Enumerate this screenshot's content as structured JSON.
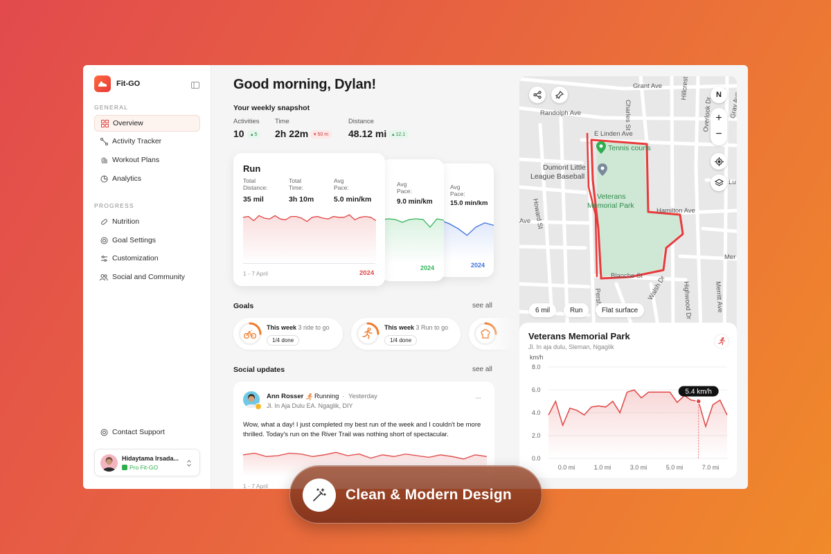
{
  "app": {
    "brand": "Fit-GO"
  },
  "sidebar": {
    "general_label": "GENERAL",
    "progress_label": "PROGRESS",
    "general_items": [
      {
        "label": "Overview",
        "icon": "grid-icon"
      },
      {
        "label": "Activity Tracker",
        "icon": "route-icon"
      },
      {
        "label": "Workout Plans",
        "icon": "hand-icon"
      },
      {
        "label": "Analytics",
        "icon": "chart-pie-icon"
      }
    ],
    "progress_items": [
      {
        "label": "Nutrition",
        "icon": "pill-icon"
      },
      {
        "label": "Goal Settings",
        "icon": "target-icon"
      },
      {
        "label": "Customization",
        "icon": "sliders-icon"
      },
      {
        "label": "Social and Community",
        "icon": "users-icon"
      }
    ],
    "support": "Contact Support",
    "user": {
      "name": "Hidaytama Irsada...",
      "plan": "Pro Fit-GO"
    }
  },
  "main": {
    "greeting": "Good morning, Dylan!",
    "snapshot_title": "Your weekly snapshot",
    "stats": [
      {
        "label": "Activities",
        "value": "10",
        "delta": "5",
        "dir": "up"
      },
      {
        "label": "Time",
        "value": "2h 22m",
        "delta": "50 m",
        "dir": "down"
      },
      {
        "label": "Distance",
        "value": "48.12 mi",
        "delta": "12.1",
        "dir": "up"
      }
    ],
    "cards": {
      "run": {
        "title": "Run",
        "l1": "Total",
        "l1b": "Distance:",
        "v1": "35 mil",
        "l2": "Total",
        "l2b": "Time:",
        "v2": "3h 10m",
        "l3": "Avg",
        "l3b": "Pace:",
        "v3": "5.0 min/km",
        "range": "1 - 7 April",
        "year": "2024",
        "color": "#e04646"
      },
      "second": {
        "l1": "Avg",
        "l1b": "Pace:",
        "v1": "9.0 min/km",
        "year": "2024",
        "color": "#33b55a"
      },
      "third": {
        "l1": "Avg",
        "l1b": "Pace:",
        "v1": "15.0 min/km",
        "year": "2024",
        "color": "#3a6fe0"
      }
    },
    "goals_title": "Goals",
    "see_all": "see all",
    "goals": [
      {
        "label": "This week",
        "detail": "3 ride to go",
        "progress": "1/4 done",
        "icon": "bike-icon"
      },
      {
        "label": "This week",
        "detail": "3 Run to go",
        "progress": "1/4 done",
        "icon": "run-icon"
      }
    ],
    "social_title": "Social updates",
    "post": {
      "author": "Ann Rosser",
      "activity": "Running",
      "dot": "·",
      "time": "Yesterday",
      "location": "Jl. In Aja Dulu EA. Ngaglik, DIY",
      "text": "Wow, what a day! I just completed my best run of the week and I couldn't be more thrilled. Today's run on the River Trail was nothing short of spectacular.",
      "range": "1 - 7 April",
      "more": "···"
    }
  },
  "map": {
    "streets": [
      "Grant Ave",
      "Randolph Ave",
      "E Linden Ave",
      "Charles St",
      "Hillcrest Dr",
      "Overlook Dr",
      "Gray Ave",
      "Dumont Little",
      "League Baseball",
      "Tennis courts",
      "Veterans",
      "Memorial Park",
      "Hamilton Ave",
      "Howard St",
      "Ave",
      "Lu",
      "Mer",
      "Blanche St",
      "Walsh Dr",
      "Highwood Dr",
      "Merritt Ave",
      "Pershing"
    ],
    "compass": "N",
    "tags": [
      "6 mil",
      "Run",
      "Flat surface"
    ]
  },
  "detail": {
    "title": "Veterans Memorial Park",
    "address": "Jl. In aja dulu, Sleman, Ngaglik",
    "tooltip": "5.4 km/h"
  },
  "chart_data": {
    "type": "area",
    "ylabel": "km/h",
    "ylim": [
      0,
      8
    ],
    "yticks": [
      "8.0",
      "6.0",
      "4.0",
      "2.0",
      "0.0"
    ],
    "xticks": [
      "0.0 mi",
      "1.0 mi",
      "3.0 mi",
      "5.0 mi",
      "7.0 mi"
    ],
    "values": [
      3.8,
      5.0,
      2.9,
      4.4,
      4.2,
      3.8,
      4.5,
      4.6,
      4.5,
      5.0,
      4.0,
      5.8,
      6.0,
      5.3,
      5.8,
      5.8,
      5.8,
      5.8,
      4.9,
      5.5,
      5.1,
      5.0,
      2.8,
      4.7,
      5.1,
      3.8
    ],
    "highlight_index": 21,
    "color": "#e04646"
  },
  "cta": {
    "label": "Clean & Modern Design"
  }
}
